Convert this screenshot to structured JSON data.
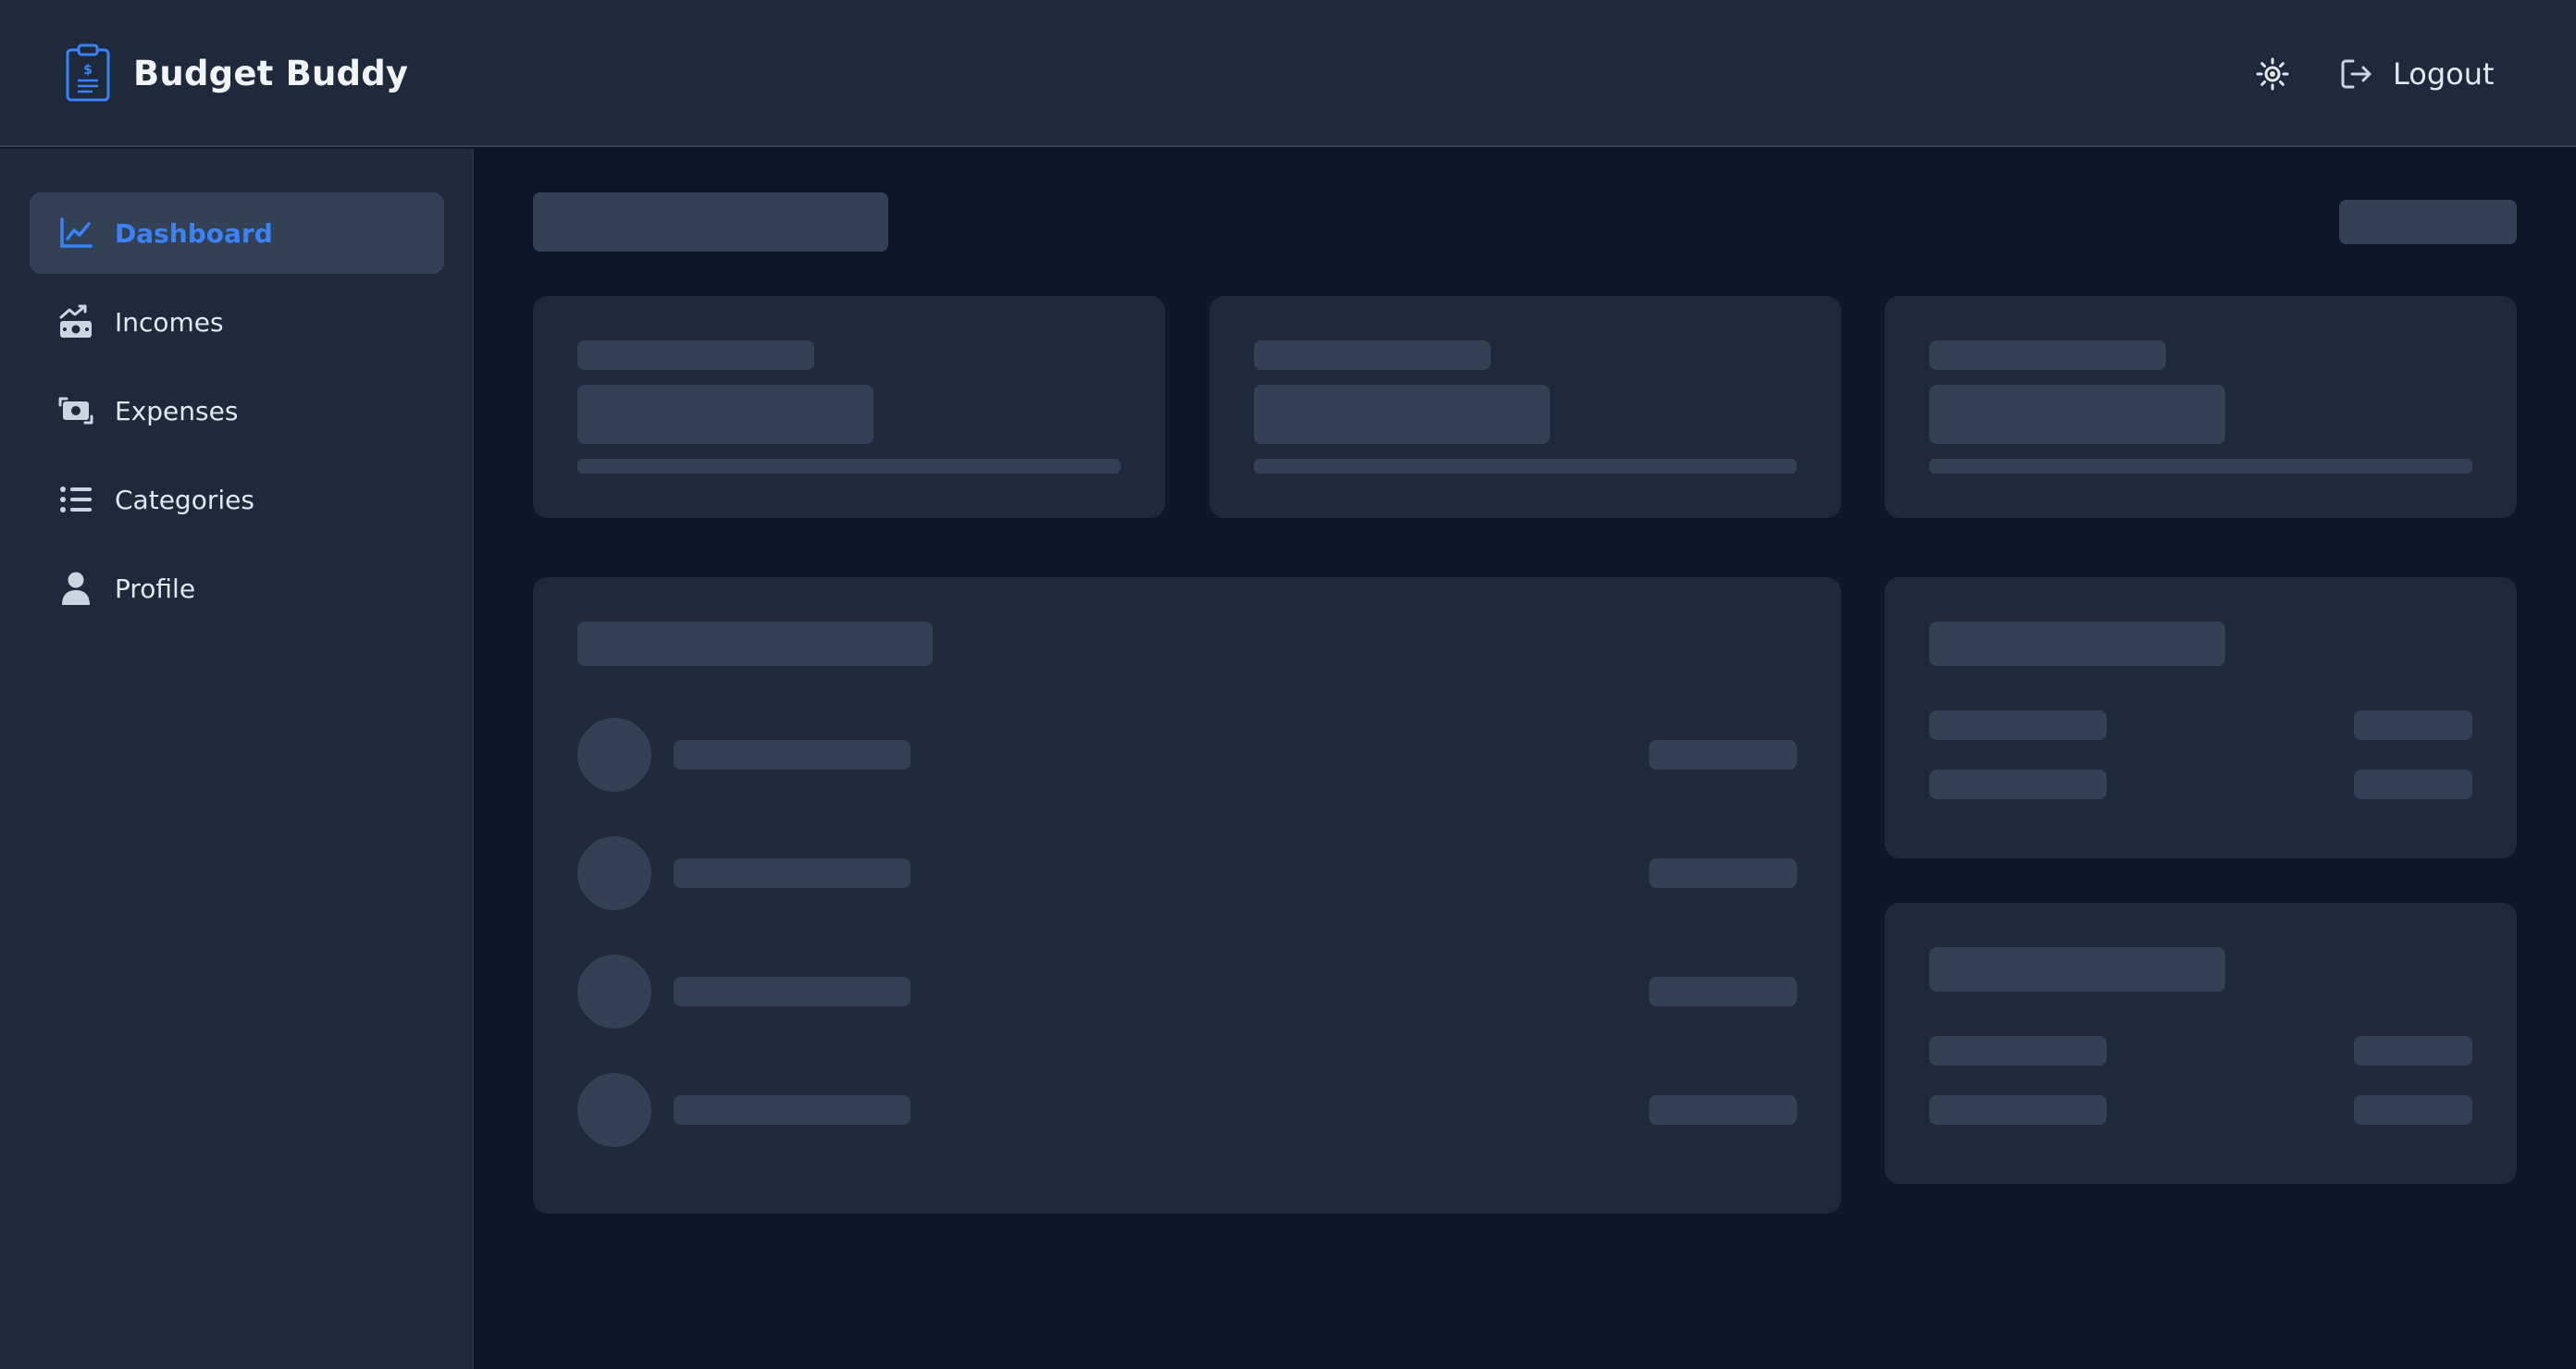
{
  "app": {
    "title": "Budget Buddy"
  },
  "header": {
    "logout_label": "Logout",
    "icons": {
      "brand": "clipboard-dollar-icon",
      "theme": "sun-icon",
      "logout": "logout-icon"
    }
  },
  "sidebar": {
    "items": [
      {
        "label": "Dashboard",
        "icon": "chart-line-icon",
        "active": true
      },
      {
        "label": "Incomes",
        "icon": "money-trend-up-icon",
        "active": false
      },
      {
        "label": "Expenses",
        "icon": "money-bill-transfer-icon",
        "active": false
      },
      {
        "label": "Categories",
        "icon": "list-icon",
        "active": false
      },
      {
        "label": "Profile",
        "icon": "user-icon",
        "active": false
      }
    ]
  },
  "main": {
    "state": "loading-skeleton",
    "summary_card_count": 3,
    "transaction_placeholder_rows": 4,
    "side_card_count": 2
  },
  "colors": {
    "page_bg": "#0f172a",
    "surface": "#1e293b",
    "skeleton": "#334155",
    "accent": "#3b82f6",
    "text": "#e2e8f0"
  }
}
